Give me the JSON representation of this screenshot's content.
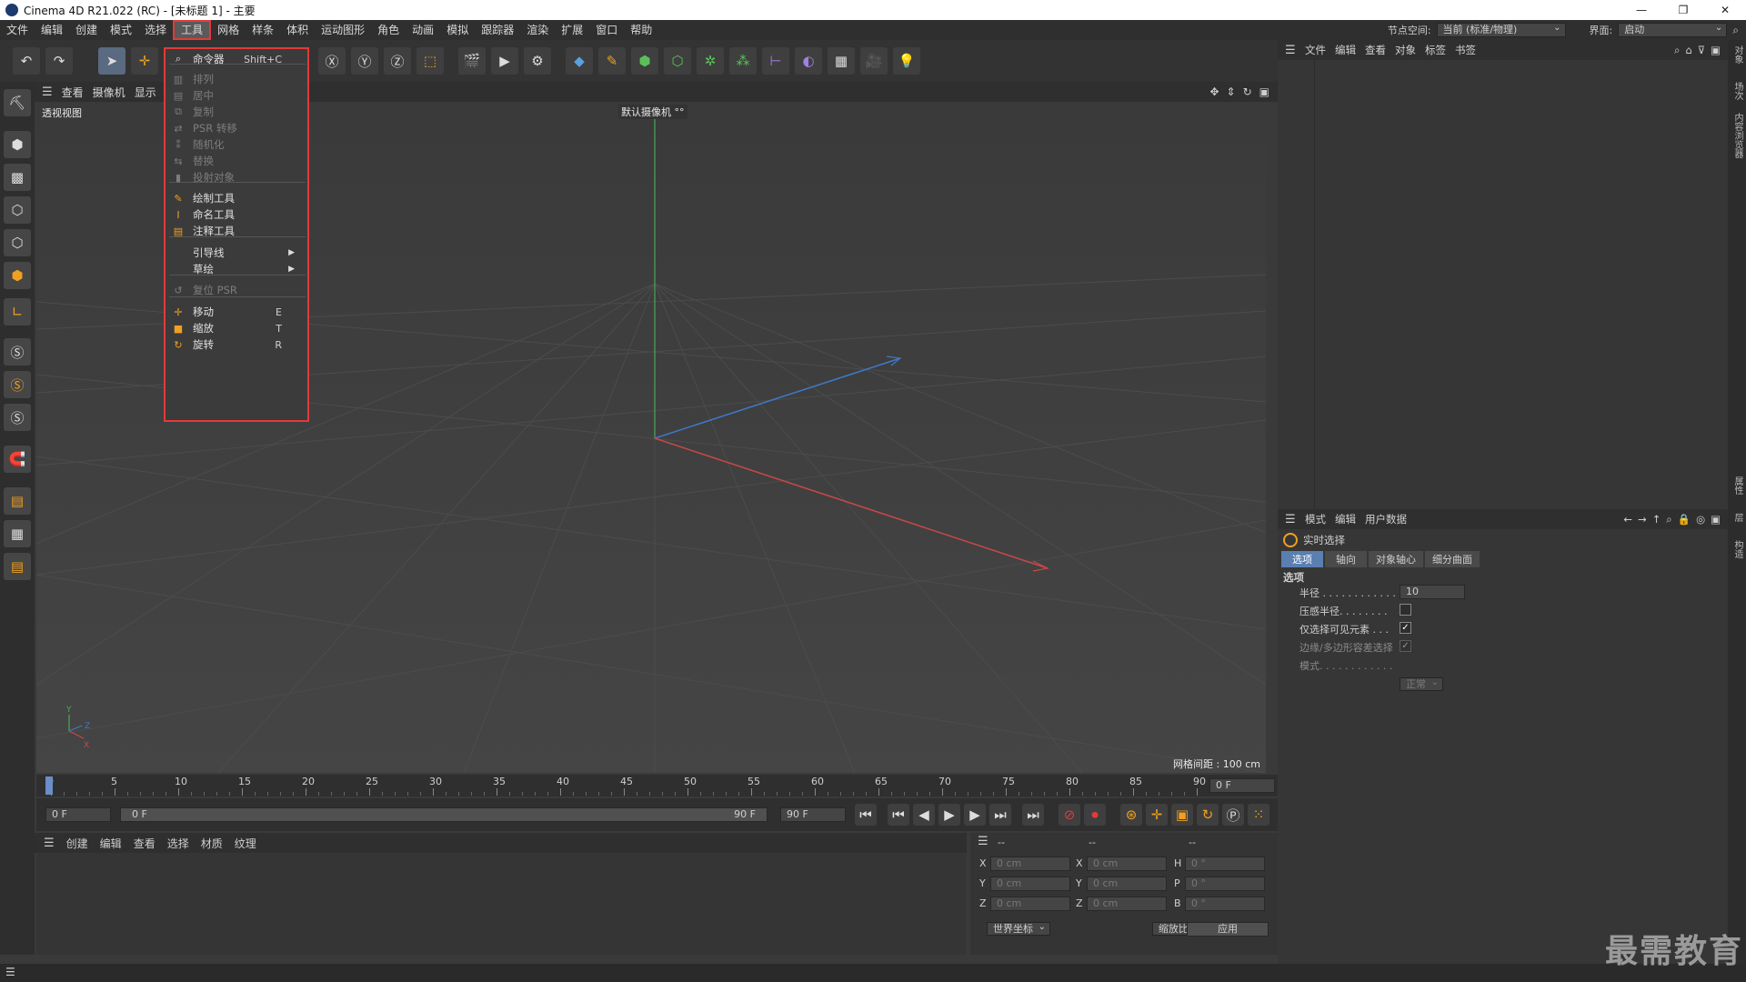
{
  "window": {
    "title": "Cinema 4D R21.022 (RC) - [未标题 1] - 主要",
    "minimize": "—",
    "restore": "❐",
    "close": "✕"
  },
  "menu": {
    "items": [
      "文件",
      "编辑",
      "创建",
      "模式",
      "选择",
      "工具",
      "网格",
      "样条",
      "体积",
      "运动图形",
      "角色",
      "动画",
      "模拟",
      "跟踪器",
      "渲染",
      "扩展",
      "窗口",
      "帮助"
    ],
    "active_index": 5,
    "node_space_label": "节点空间:",
    "node_space_value": "当前 (标准/物理)",
    "layout_label": "界面:",
    "layout_value": "启动"
  },
  "tools_menu": [
    {
      "label": "命令器",
      "shortcut": "Shift+C",
      "icon": "search-icon",
      "enabled": true
    },
    {
      "label": "排列",
      "shortcut": "",
      "icon": "arrange-icon",
      "enabled": false
    },
    {
      "label": "居中",
      "shortcut": "",
      "icon": "center-icon",
      "enabled": false
    },
    {
      "label": "复制",
      "shortcut": "",
      "icon": "duplicate-icon",
      "enabled": false
    },
    {
      "label": "PSR 转移",
      "shortcut": "",
      "icon": "transfer-icon",
      "enabled": false
    },
    {
      "label": "随机化",
      "shortcut": "",
      "icon": "randomize-icon",
      "enabled": false
    },
    {
      "label": "替换",
      "shortcut": "",
      "icon": "replace-icon",
      "enabled": false
    },
    {
      "label": "投射对象",
      "shortcut": "",
      "icon": "project-icon",
      "enabled": false
    },
    {
      "label": "绘制工具",
      "shortcut": "",
      "icon": "paint-icon",
      "enabled": true
    },
    {
      "label": "命名工具",
      "shortcut": "",
      "icon": "naming-icon",
      "enabled": true
    },
    {
      "label": "注释工具",
      "shortcut": "",
      "icon": "annotation-icon",
      "enabled": true
    },
    {
      "label": "引导线",
      "shortcut": "",
      "icon": "",
      "enabled": true,
      "submenu": true
    },
    {
      "label": "草绘",
      "shortcut": "",
      "icon": "",
      "enabled": true,
      "submenu": true
    },
    {
      "label": "复位 PSR",
      "shortcut": "",
      "icon": "reset-icon",
      "enabled": false
    },
    {
      "label": "移动",
      "shortcut": "E",
      "icon": "move-icon",
      "enabled": true
    },
    {
      "label": "缩放",
      "shortcut": "T",
      "icon": "scale-icon",
      "enabled": true
    },
    {
      "label": "旋转",
      "shortcut": "R",
      "icon": "rotate-icon",
      "enabled": true
    }
  ],
  "viewport": {
    "menu": [
      "查看",
      "摄像机",
      "显示"
    ],
    "view_name": "透视视图",
    "camera_label": "默认摄像机 °°",
    "grid_label": "网格间距 : 100 cm"
  },
  "timeline": {
    "ticks": [
      "0",
      "5",
      "10",
      "15",
      "20",
      "25",
      "30",
      "35",
      "40",
      "45",
      "50",
      "55",
      "60",
      "65",
      "70",
      "75",
      "80",
      "85",
      "90"
    ],
    "frame_end_display": "0 F",
    "start_frame": "0 F",
    "range_start": "0 F",
    "range_end": "90 F",
    "end_frame": "90 F"
  },
  "material_menu": [
    "创建",
    "编辑",
    "查看",
    "选择",
    "材质",
    "纹理"
  ],
  "objects_menu": [
    "文件",
    "编辑",
    "查看",
    "对象",
    "标签",
    "书签"
  ],
  "attributes": {
    "menu": [
      "模式",
      "编辑",
      "用户数据"
    ],
    "tool_name": "实时选择",
    "tabs": [
      "选项",
      "轴向",
      "对象轴心",
      "细分曲面"
    ],
    "section": "选项",
    "rows": [
      {
        "label": "半径 . . . . . . . . . . . .",
        "value": "10"
      },
      {
        "label": "压感半径. . . . . . . .",
        "value": ""
      },
      {
        "label": "仅选择可见元素 . . .",
        "value": ""
      },
      {
        "label": "边缘/多边形容差选择",
        "value": ""
      },
      {
        "label": "模式. . . . . . . . . . . .",
        "value": "正常"
      }
    ]
  },
  "coordinates": {
    "headers": [
      "--",
      "--",
      "--"
    ],
    "rows": [
      {
        "a": "X",
        "av": "0 cm",
        "b": "X",
        "bv": "0 cm",
        "c": "H",
        "cv": "0 °"
      },
      {
        "a": "Y",
        "av": "0 cm",
        "b": "Y",
        "bv": "0 cm",
        "c": "P",
        "cv": "0 °"
      },
      {
        "a": "Z",
        "av": "0 cm",
        "b": "Z",
        "bv": "0 cm",
        "c": "B",
        "cv": "0 °"
      }
    ],
    "world_label": "世界坐标",
    "scale_label": "缩放比例",
    "apply_label": "应用"
  },
  "side_tabs": [
    "对象",
    "场次",
    "内容浏览器",
    "属性",
    "层",
    "构造"
  ],
  "watermark": "最需教育",
  "colors": {
    "accent_red": "#e23a3a",
    "x_axis": "#c94848",
    "y_axis": "#4aa85a",
    "z_axis": "#3f78c8"
  }
}
